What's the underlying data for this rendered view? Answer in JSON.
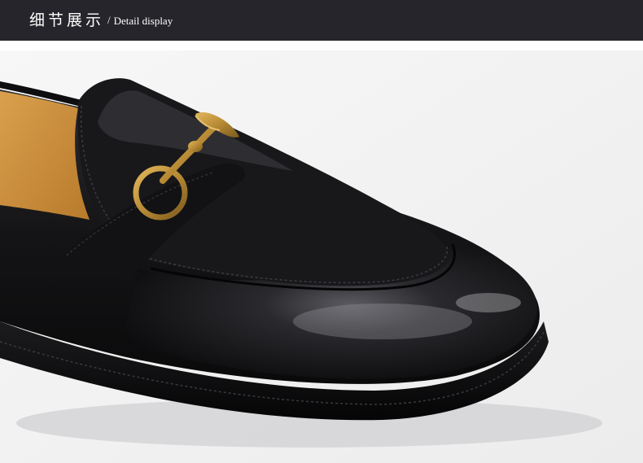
{
  "header": {
    "title_zh": "细节展示",
    "separator": "/",
    "title_en": "Detail display"
  },
  "photo": {
    "subject": "black leather loafer with gold horsebit buckle",
    "colors": {
      "background": "#f4f4f4",
      "leather": "#141416",
      "lining": "#c9913e",
      "hardware": "#b88a35",
      "header_bar": "#25252b"
    }
  }
}
